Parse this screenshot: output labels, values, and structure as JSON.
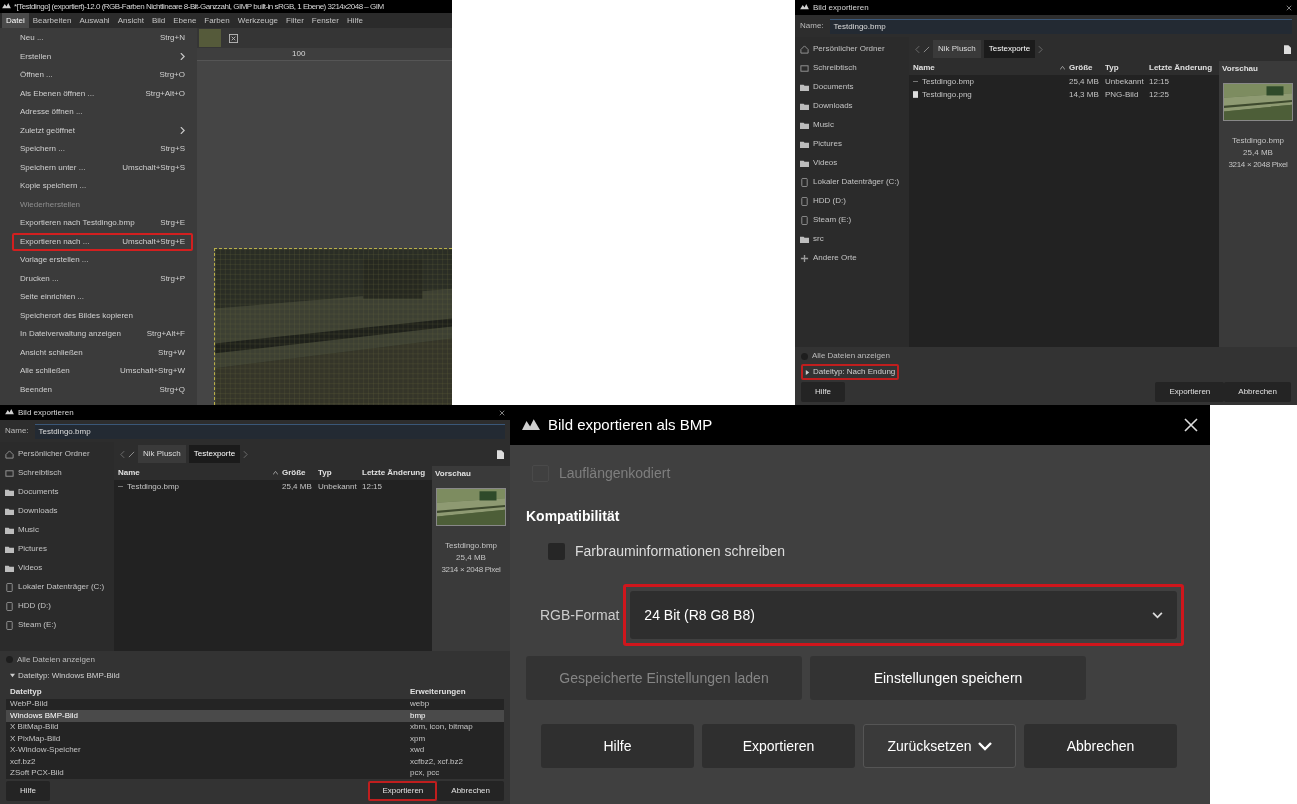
{
  "gimp_window": {
    "title": "*[Testdingo] (exportiert)-12.0 (RGB-Farben Nichtlineare 8-Bit-Ganzzahl, GIMP built-in sRGB, 1 Ebene) 3214x2048 – GIM",
    "menubar": [
      {
        "label": "Datei",
        "selected": true
      },
      {
        "label": "Bearbeiten",
        "selected": false
      },
      {
        "label": "Auswahl",
        "selected": false
      },
      {
        "label": "Ansicht",
        "selected": false
      },
      {
        "label": "Bild",
        "selected": false
      },
      {
        "label": "Ebene",
        "selected": false
      },
      {
        "label": "Farben",
        "selected": false
      },
      {
        "label": "Werkzeuge",
        "selected": false
      },
      {
        "label": "Filter",
        "selected": false
      },
      {
        "label": "Fenster",
        "selected": false
      },
      {
        "label": "Hilfe",
        "selected": false
      }
    ],
    "menu_items": [
      {
        "label": "Neu ...",
        "shortcut": "Strg+N",
        "kind": "item",
        "disabled": false,
        "highlighted": false
      },
      {
        "label": "Erstellen",
        "kind": "submenu",
        "disabled": false,
        "highlighted": false
      },
      {
        "label": "Öffnen ...",
        "shortcut": "Strg+O",
        "kind": "item",
        "disabled": false,
        "highlighted": false
      },
      {
        "label": "Als Ebenen öffnen ...",
        "shortcut": "Strg+Alt+O",
        "kind": "item",
        "disabled": false,
        "highlighted": false
      },
      {
        "label": "Adresse öffnen ...",
        "kind": "item",
        "disabled": false,
        "highlighted": false
      },
      {
        "label": "Zuletzt geöffnet",
        "kind": "submenu",
        "disabled": false,
        "highlighted": false
      },
      {
        "label": "Speichern ...",
        "shortcut": "Strg+S",
        "kind": "item",
        "disabled": false,
        "highlighted": false
      },
      {
        "label": "Speichern unter ...",
        "shortcut": "Umschalt+Strg+S",
        "kind": "item",
        "disabled": false,
        "highlighted": false
      },
      {
        "label": "Kopie speichern ...",
        "kind": "item",
        "disabled": false,
        "highlighted": false
      },
      {
        "label": "Wiederherstellen",
        "kind": "item",
        "disabled": true,
        "highlighted": false
      },
      {
        "label": "Exportieren nach Testdingo.bmp",
        "shortcut": "Strg+E",
        "kind": "item",
        "disabled": false,
        "highlighted": false
      },
      {
        "label": "Exportieren nach ...",
        "shortcut": "Umschalt+Strg+E",
        "kind": "item",
        "disabled": false,
        "highlighted": true
      },
      {
        "label": "Vorlage erstellen ...",
        "kind": "item",
        "disabled": false,
        "highlighted": false
      },
      {
        "label": "Drucken ...",
        "shortcut": "Strg+P",
        "kind": "item",
        "disabled": false,
        "highlighted": false
      },
      {
        "label": "Seite einrichten ...",
        "kind": "item",
        "disabled": false,
        "highlighted": false
      },
      {
        "label": "Speicherort des Bildes kopieren",
        "kind": "item",
        "disabled": false,
        "highlighted": false
      },
      {
        "label": "In Dateiverwaltung anzeigen",
        "shortcut": "Strg+Alt+F",
        "kind": "item",
        "disabled": false,
        "highlighted": false
      },
      {
        "label": "Ansicht schließen",
        "shortcut": "Strg+W",
        "kind": "item",
        "disabled": false,
        "highlighted": false
      },
      {
        "label": "Alle schließen",
        "shortcut": "Umschalt+Strg+W",
        "kind": "item",
        "disabled": false,
        "highlighted": false
      },
      {
        "label": "Beenden",
        "shortcut": "Strg+Q",
        "kind": "item",
        "disabled": false,
        "highlighted": false
      }
    ],
    "ruler_label": "100"
  },
  "export_dialog_collapsed": {
    "title": "Bild exportieren",
    "name_label": "Name:",
    "name_value": "Testdingo.bmp",
    "sidebar": [
      {
        "label": "Persönlicher Ordner",
        "kind": "home"
      },
      {
        "label": "Schreibtisch",
        "kind": "desktop"
      },
      {
        "label": "Documents",
        "kind": "folder"
      },
      {
        "label": "Downloads",
        "kind": "folder"
      },
      {
        "label": "Music",
        "kind": "folder"
      },
      {
        "label": "Pictures",
        "kind": "folder"
      },
      {
        "label": "Videos",
        "kind": "folder"
      },
      {
        "label": "Lokaler Datenträger (C:)",
        "kind": "drive"
      },
      {
        "label": "HDD (D:)",
        "kind": "drive"
      },
      {
        "label": "Steam (E:)",
        "kind": "drive"
      },
      {
        "label": "src",
        "kind": "folder"
      },
      {
        "label": "Andere Orte",
        "kind": "plus"
      }
    ],
    "path": [
      {
        "label": "Nik Plusch",
        "selected": false
      },
      {
        "label": "Testexporte",
        "selected": true
      }
    ],
    "columns": [
      "Name",
      "Größe",
      "Typ",
      "Letzte Änderung",
      "Vorschau"
    ],
    "rows": [
      {
        "name": "Testdingo.bmp",
        "size": "25,4 MB",
        "type": "Unbekannt",
        "modified": "12:15",
        "kind": "recent"
      },
      {
        "name": "Testdingo.png",
        "size": "14,3 MB",
        "type": "PNG-Bild",
        "modified": "12:25",
        "kind": "file"
      }
    ],
    "preview": {
      "name": "Testdingo.bmp",
      "size": "25,4 MB",
      "dims": "3214 × 2048 Pixel"
    },
    "show_all": {
      "label": "Alle Dateien anzeigen",
      "checked": false
    },
    "filetype": {
      "label": "Dateityp: Nach Endung",
      "expanded": false,
      "highlighted": true
    },
    "buttons": [
      {
        "label": "Hilfe",
        "highlighted": false
      },
      {
        "label": "Exportieren",
        "highlighted": false
      },
      {
        "label": "Abbrechen",
        "highlighted": false
      }
    ]
  },
  "export_dialog_expanded": {
    "title": "Bild exportieren",
    "name_label": "Name:",
    "name_value": "Testdingo.bmp",
    "sidebar": [
      {
        "label": "Persönlicher Ordner",
        "kind": "home"
      },
      {
        "label": "Schreibtisch",
        "kind": "desktop"
      },
      {
        "label": "Documents",
        "kind": "folder"
      },
      {
        "label": "Downloads",
        "kind": "folder"
      },
      {
        "label": "Music",
        "kind": "folder"
      },
      {
        "label": "Pictures",
        "kind": "folder"
      },
      {
        "label": "Videos",
        "kind": "folder"
      },
      {
        "label": "Lokaler Datenträger (C:)",
        "kind": "drive"
      },
      {
        "label": "HDD (D:)",
        "kind": "drive"
      },
      {
        "label": "Steam (E:)",
        "kind": "drive"
      }
    ],
    "path": [
      {
        "label": "Nik Plusch",
        "selected": false
      },
      {
        "label": "Testexporte",
        "selected": true
      }
    ],
    "columns": [
      "Name",
      "Größe",
      "Typ",
      "Letzte Änderung",
      "Vorschau"
    ],
    "rows": [
      {
        "name": "Testdingo.bmp",
        "size": "25,4 MB",
        "type": "Unbekannt",
        "modified": "12:15",
        "kind": "recent"
      }
    ],
    "preview": {
      "name": "Testdingo.bmp",
      "size": "25,4 MB",
      "dims": "3214 × 2048 Pixel"
    },
    "show_all": {
      "label": "Alle Dateien anzeigen",
      "checked": false
    },
    "filetype": {
      "label": "Dateityp: Windows BMP-Bild",
      "expanded": true,
      "highlighted": false
    },
    "filetype_columns": [
      "Dateityp",
      "Erweiterungen"
    ],
    "filetypes": [
      {
        "name": "WebP-Bild",
        "ext": "webp",
        "selected": false
      },
      {
        "name": "Windows BMP-Bild",
        "ext": "bmp",
        "selected": true
      },
      {
        "name": "X BitMap-Bild",
        "ext": "xbm, icon, bitmap",
        "selected": false
      },
      {
        "name": "X PixMap-Bild",
        "ext": "xpm",
        "selected": false
      },
      {
        "name": "X-Window-Speicher",
        "ext": "xwd",
        "selected": false
      },
      {
        "name": "xcf.bz2",
        "ext": "xcfbz2, xcf.bz2",
        "selected": false
      },
      {
        "name": "ZSoft PCX-Bild",
        "ext": "pcx, pcc",
        "selected": false
      }
    ],
    "buttons": [
      {
        "label": "Hilfe",
        "highlighted": false
      },
      {
        "label": "Exportieren",
        "highlighted": true
      },
      {
        "label": "Abbrechen",
        "highlighted": false
      }
    ]
  },
  "bmp_dialog": {
    "title": "Bild exportieren als BMP",
    "run_length": {
      "label": "Lauflängenkodiert",
      "checked": false,
      "disabled": true
    },
    "section": "Kompatibilität",
    "colorspace": {
      "label": "Farbrauminformationen schreiben",
      "checked": false
    },
    "rgb_format": {
      "label": "RGB-Format",
      "value": "24 Bit (R8 G8 B8)",
      "highlighted": true
    },
    "settings_buttons": [
      {
        "label": "Gespeicherte Einstellungen laden",
        "disabled": true
      },
      {
        "label": "Einstellungen speichern",
        "disabled": false
      }
    ],
    "buttons": [
      {
        "label": "Hilfe",
        "kind": "plain"
      },
      {
        "label": "Exportieren",
        "kind": "plain"
      },
      {
        "label": "Zurücksetzen",
        "kind": "dropdown"
      },
      {
        "label": "Abbrechen",
        "kind": "plain"
      }
    ]
  }
}
